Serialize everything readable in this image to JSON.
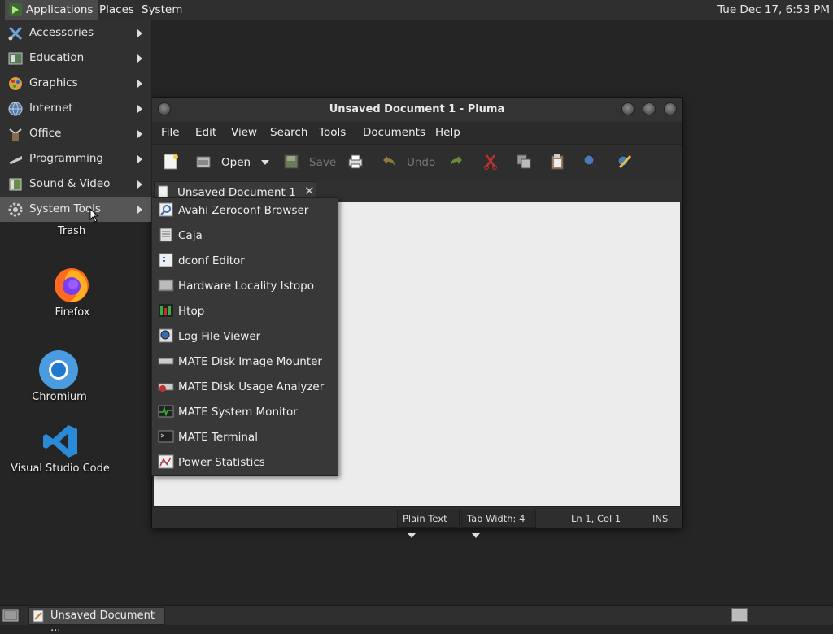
{
  "top_panel": {
    "applications": "Applications",
    "places": "Places",
    "system": "System",
    "clock": "Tue Dec 17,  6:53 PM"
  },
  "apps_menu": {
    "items": [
      {
        "label": "Accessories",
        "icon": "accessories-icon"
      },
      {
        "label": "Education",
        "icon": "education-icon"
      },
      {
        "label": "Graphics",
        "icon": "graphics-icon"
      },
      {
        "label": "Internet",
        "icon": "internet-icon"
      },
      {
        "label": "Office",
        "icon": "office-icon"
      },
      {
        "label": "Programming",
        "icon": "programming-icon"
      },
      {
        "label": "Sound & Video",
        "icon": "sound-video-icon"
      },
      {
        "label": "System Tools",
        "icon": "system-tools-icon"
      }
    ]
  },
  "submenu": {
    "items": [
      {
        "label": "Avahi Zeroconf Browser",
        "icon": "avahi-icon"
      },
      {
        "label": "Caja",
        "icon": "caja-icon"
      },
      {
        "label": "dconf Editor",
        "icon": "dconf-icon"
      },
      {
        "label": "Hardware Locality lstopo",
        "icon": "lstopo-icon"
      },
      {
        "label": "Htop",
        "icon": "htop-icon"
      },
      {
        "label": "Log File Viewer",
        "icon": "log-viewer-icon"
      },
      {
        "label": "MATE Disk Image Mounter",
        "icon": "disk-mounter-icon"
      },
      {
        "label": "MATE Disk Usage Analyzer",
        "icon": "disk-usage-icon"
      },
      {
        "label": "MATE System Monitor",
        "icon": "system-monitor-icon"
      },
      {
        "label": "MATE Terminal",
        "icon": "terminal-icon"
      },
      {
        "label": "Power Statistics",
        "icon": "power-stats-icon"
      }
    ]
  },
  "desktop": {
    "trash": "Trash",
    "firefox": "Firefox",
    "chromium": "Chromium",
    "vscode": "Visual Studio Code"
  },
  "window": {
    "title": "Unsaved Document 1 - Pluma",
    "menu": [
      "File",
      "Edit",
      "View",
      "Search",
      "Tools",
      "Documents",
      "Help"
    ],
    "toolbar": {
      "open": "Open",
      "save": "Save",
      "undo": "Undo"
    },
    "tab_label": "Unsaved Document 1",
    "status": {
      "language": "Plain Text",
      "tab_width": "Tab Width:  4",
      "position": "Ln 1, Col 1",
      "mode": "INS"
    }
  },
  "taskbar": {
    "item": "Unsaved Document ..."
  }
}
